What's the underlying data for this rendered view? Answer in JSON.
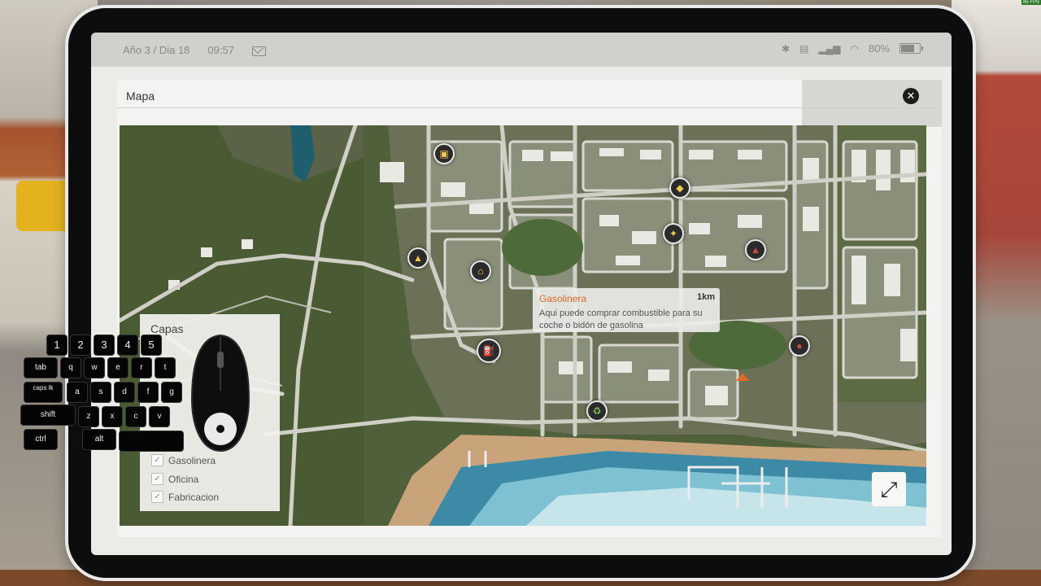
{
  "status": {
    "date": "Año 3 / Dia 18",
    "time": "09:57",
    "battery": "80%",
    "icons": [
      "mail-icon",
      "bluetooth-icon",
      "sim-icon",
      "signal-icon",
      "wifi-icon",
      "battery-icon"
    ]
  },
  "window": {
    "title": "Mapa",
    "close_icon": "close-icon"
  },
  "tooltip": {
    "title": "Gasolinera",
    "distance": "1km",
    "description": "Aqui puede comprar combustible para su coche o bidón de gasolina"
  },
  "layers": {
    "title": "Capas",
    "items": [
      {
        "label": "Gasolinera",
        "checked": true
      },
      {
        "label": "Oficina",
        "checked": true
      },
      {
        "label": "Fabricacion",
        "checked": true
      }
    ]
  },
  "keyboard": {
    "row1": [
      "1",
      "2",
      "3",
      "4",
      "5"
    ],
    "row2": [
      "tab",
      "q",
      "w",
      "e",
      "r",
      "t"
    ],
    "row3": [
      "caps lk",
      "a",
      "s",
      "d",
      "f",
      "g"
    ],
    "row4": [
      "shift",
      "z",
      "x",
      "c",
      "v"
    ],
    "row5": [
      "ctrl",
      "alt"
    ]
  },
  "markers": [
    {
      "name": "shop-icon",
      "glyph": "▣"
    },
    {
      "name": "store-icon",
      "glyph": "▲"
    },
    {
      "name": "bank-icon",
      "glyph": "⌂"
    },
    {
      "name": "gas-station-icon",
      "glyph": "⛽"
    },
    {
      "name": "gift-icon",
      "glyph": "◆"
    },
    {
      "name": "tool-icon",
      "glyph": "✦"
    },
    {
      "name": "cake-icon",
      "glyph": "▲"
    },
    {
      "name": "sale-icon",
      "glyph": "●"
    },
    {
      "name": "recycle-icon",
      "glyph": "♻"
    }
  ],
  "fps": "85 FPS",
  "colors": {
    "accent": "#e0692a",
    "tablet": "#0d0d0d",
    "screen": "#ebebe8"
  }
}
